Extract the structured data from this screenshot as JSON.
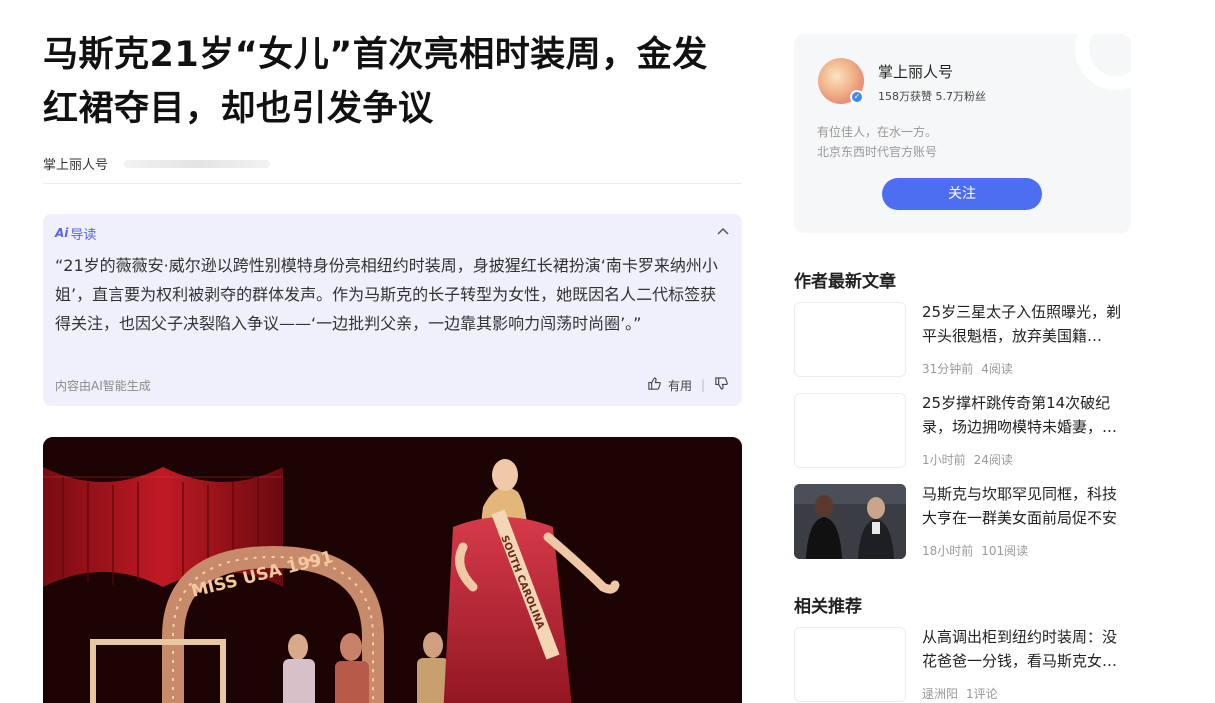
{
  "article": {
    "title": "马斯克21岁“女儿”首次亮相时装周，金发红裙夺目，却也引发争议",
    "source": "掌上丽人号"
  },
  "ai_summary": {
    "label": "导读",
    "logo_text": "Ai",
    "text": "“21岁的薇薇安·威尔逊以跨性别模特身份亮相纽约时装周，身披猩红长裙扮演‘南卡罗来纳州小姐’，直言要为权利被剥夺的群体发声。作为马斯克的长子转型为女性，她既因名人二代标签获得关注，也因父子决裂陷入争议——‘一边批判父亲，一边靠其影响力闯荡时尚圈’。”",
    "generated_note": "内容由AI智能生成",
    "useful_label": "有用"
  },
  "photo": {
    "sign_text": "MISS USA 1991",
    "sash_text": "SOUTH CAROLINA"
  },
  "author": {
    "name": "掌上丽人号",
    "stats": "158万获赞 5.7万粉丝",
    "bio_line1": "有位佳人，在水一方。",
    "bio_line2": "北京东西时代官方账号",
    "follow_label": "关注"
  },
  "latest_articles": {
    "heading": "作者最新文章",
    "items": [
      {
        "title": "25岁三星太子入伍照曝光，剃平头很魁梧，放弃美国籍…",
        "time": "31分钟前",
        "reads": "4阅读"
      },
      {
        "title": "25岁撑杆跳传奇第14次破纪录，场边拥吻模特未婚妻，…",
        "time": "1小时前",
        "reads": "24阅读"
      },
      {
        "title": "马斯克与坎耶罕见同框，科技大亨在一群美女面前局促不安",
        "time": "18小时前",
        "reads": "101阅读"
      }
    ]
  },
  "related": {
    "heading": "相关推荐",
    "items": [
      {
        "title": "从高调出柜到纽约时装周：没花爸爸一分钱，看马斯克女…",
        "author": "逯洲阳",
        "comments": "1评论"
      }
    ]
  },
  "colors": {
    "accent": "#4e6ef2",
    "ai_bg": "#eff0fb",
    "ai_text": "#5a63e6"
  }
}
